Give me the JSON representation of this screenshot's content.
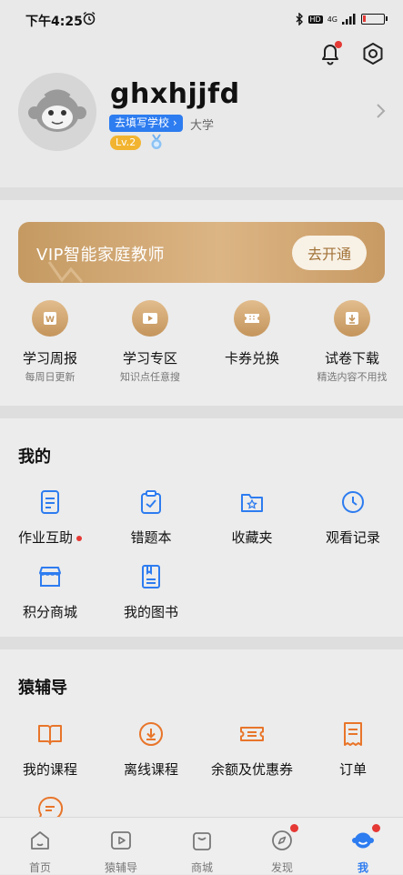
{
  "status_bar": {
    "time": "下午4:25",
    "network": "4G"
  },
  "profile": {
    "username": "ghxhjjfd",
    "school_button": "去填写学校",
    "school_level": "大学",
    "level": "Lv.2"
  },
  "vip": {
    "title": "VIP智能家庭教师",
    "button": "去开通"
  },
  "features": [
    {
      "label": "学习周报",
      "sub": "每周日更新"
    },
    {
      "label": "学习专区",
      "sub": "知识点任意搜"
    },
    {
      "label": "卡券兑换",
      "sub": ""
    },
    {
      "label": "试卷下载",
      "sub": "精选内容不用找"
    }
  ],
  "mine": {
    "title": "我的",
    "items": [
      "作业互助",
      "错题本",
      "收藏夹",
      "观看记录",
      "积分商城",
      "我的图书"
    ]
  },
  "tutor": {
    "title": "猿辅导",
    "items": [
      "我的课程",
      "离线课程",
      "余额及优惠券",
      "订单"
    ]
  },
  "nav": [
    "首页",
    "猿辅导",
    "商城",
    "发现",
    "我"
  ],
  "colors": {
    "accent": "#2d7cf0",
    "gold": "#c9a06a",
    "orange": "#e8752a",
    "badge": "#e53935"
  }
}
